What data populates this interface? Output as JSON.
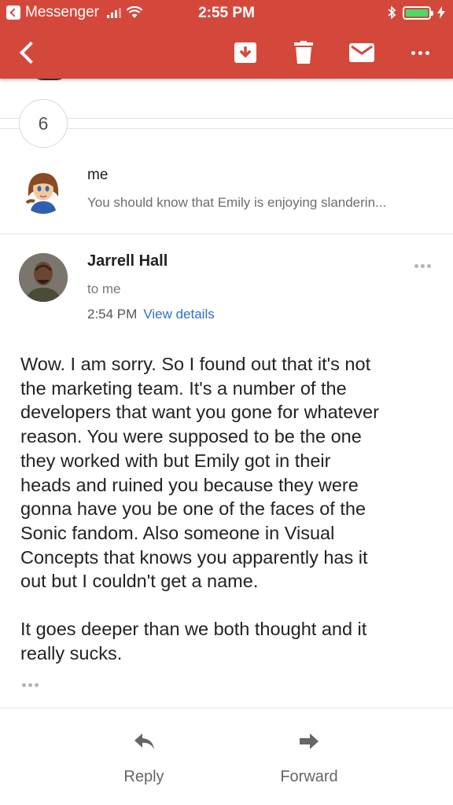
{
  "status_bar": {
    "back_app_label": "Messenger",
    "time": "2:55 PM",
    "battery_color": "#4cd964"
  },
  "app_bar": {
    "background": "#d4483b",
    "icons": [
      "back-icon",
      "archive-icon",
      "delete-icon",
      "mark-unread-icon",
      "more-icon"
    ]
  },
  "thread": {
    "collapsed_count": "6",
    "previous_message": {
      "sender": "me",
      "snippet": "You should know that Emily is enjoying slanderin..."
    },
    "message": {
      "sender": "Jarrell Hall",
      "recipient": "to me",
      "time": "2:54 PM",
      "view_details": "View details",
      "body_paragraphs": [
        "Wow. I am sorry. So I found out that it's not\nthe marketing team. It's a number of the\ndevelopers that want you gone for whatever\nreason. You were supposed to be the one\nthey worked with but Emily got in their\nheads and ruined you because they were\ngonna have you be one of the faces of the\nSonic fandom. Also someone in Visual\nConcepts that knows you apparently has it\nout but I couldn't get a name.",
        "It goes deeper than we both thought and it\nreally sucks."
      ]
    }
  },
  "actions": {
    "reply": "Reply",
    "forward": "Forward"
  }
}
